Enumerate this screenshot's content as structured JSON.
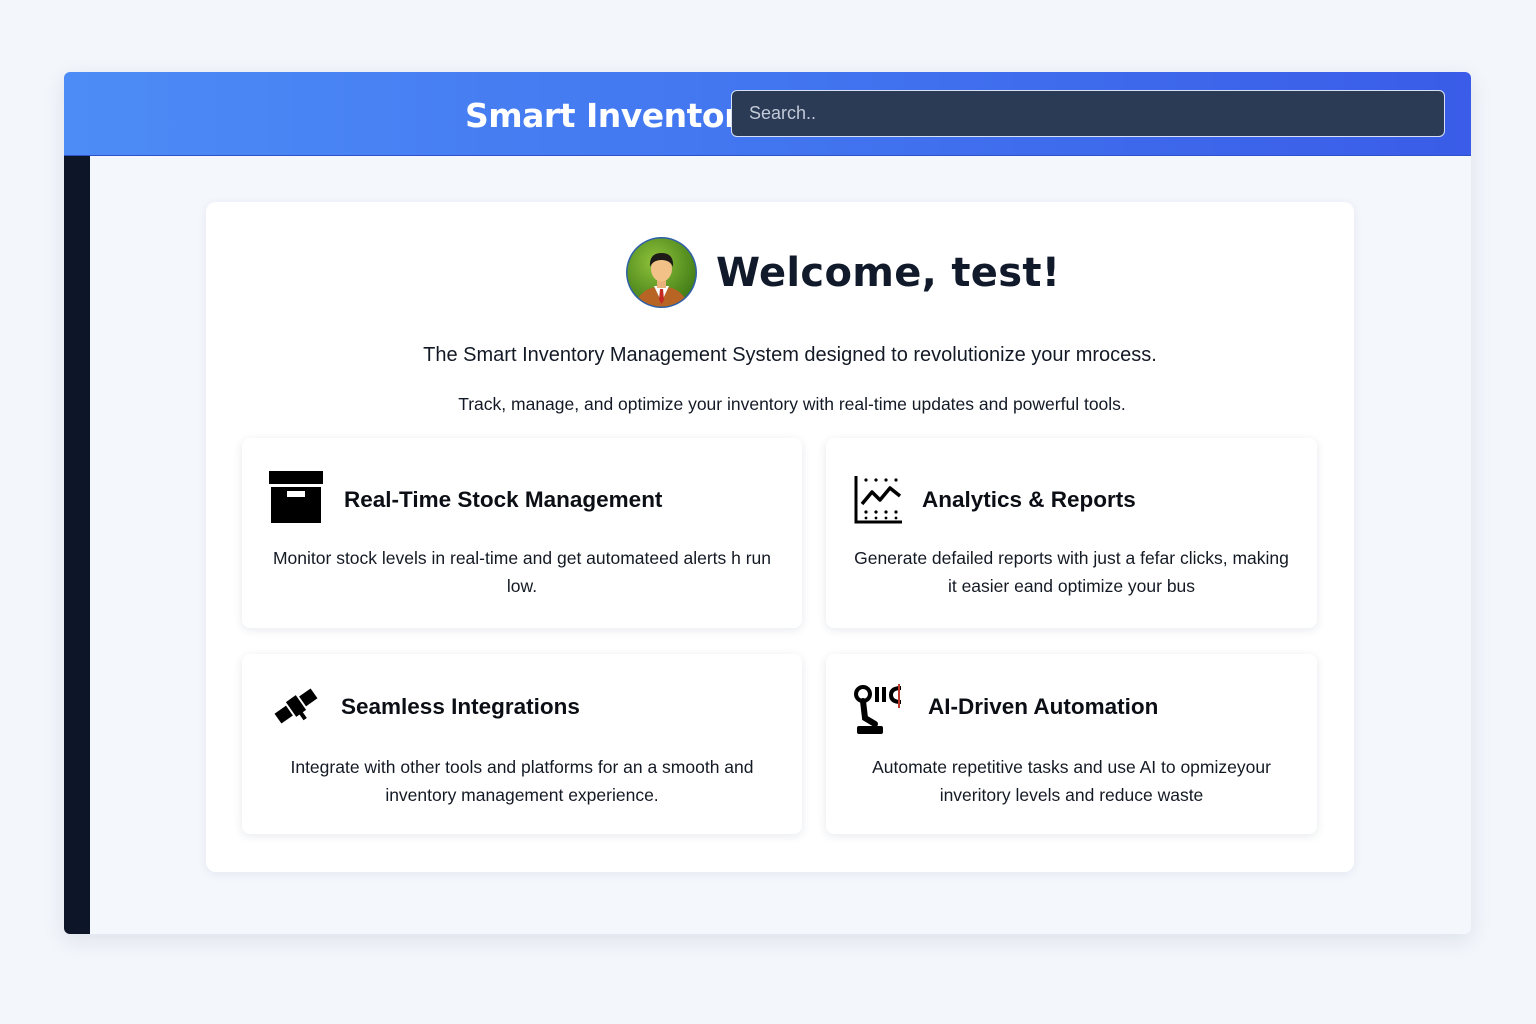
{
  "header": {
    "app_title": "Smart Inventory",
    "search_placeholder": "Search.."
  },
  "welcome": {
    "title": "Welcome, test!",
    "avatar_icon": "user-avatar-icon",
    "intro_line_1": "The Smart Inventory Management System designed to revolutionize your mrocess.",
    "intro_line_2": "Track, manage, and optimize your inventory with real-time updates and powerful tools."
  },
  "features": [
    {
      "icon": "archive-box-icon",
      "title": "Real-Time Stock Management",
      "description": "Monitor stock levels in real-time and get automateed alerts h run low."
    },
    {
      "icon": "analytics-chart-icon",
      "title": "Analytics & Reports",
      "description": "Generate defailed reports with just a fefar clicks, making it easier eand optimize your bus"
    },
    {
      "icon": "satellite-icon",
      "title": "Seamless Integrations",
      "description": "Integrate with other tools and platforms for an a smooth and inventory management experience."
    },
    {
      "icon": "robot-arm-icon",
      "title": "AI-Driven Automation",
      "description": "Automate repetitive tasks and use AI to opmizeyour inveritory levels and reduce waste"
    }
  ],
  "colors": {
    "header_gradient_start": "#4d8cf6",
    "header_gradient_end": "#3a5ce8",
    "sidebar": "#0d1628",
    "search_background": "#2b3a55",
    "card_background": "#ffffff",
    "page_background": "#f3f6fb"
  }
}
